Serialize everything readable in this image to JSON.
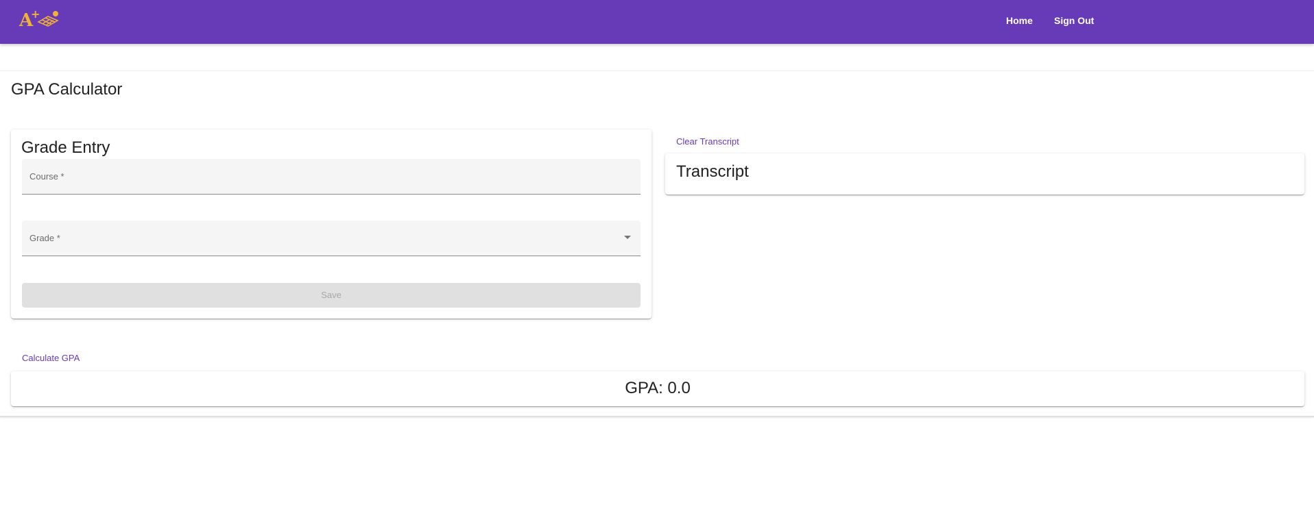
{
  "header": {
    "logo_icon": "a-plus-logo-icon",
    "brand_color": "#673ab7",
    "logo_color": "#f2b233",
    "nav": [
      {
        "label": "Home"
      },
      {
        "label": "Sign Out"
      }
    ]
  },
  "page": {
    "title": "GPA Calculator"
  },
  "grade_entry": {
    "heading": "Grade Entry",
    "course_field": {
      "label": "Course *",
      "value": ""
    },
    "grade_field": {
      "label": "Grade *",
      "value": "",
      "icon": "dropdown-arrow-icon"
    },
    "save_label": "Save"
  },
  "transcript": {
    "clear_label": "Clear Transcript",
    "heading": "Transcript"
  },
  "gpa": {
    "calculate_label": "Calculate GPA",
    "result_text": "GPA: 0.0"
  }
}
